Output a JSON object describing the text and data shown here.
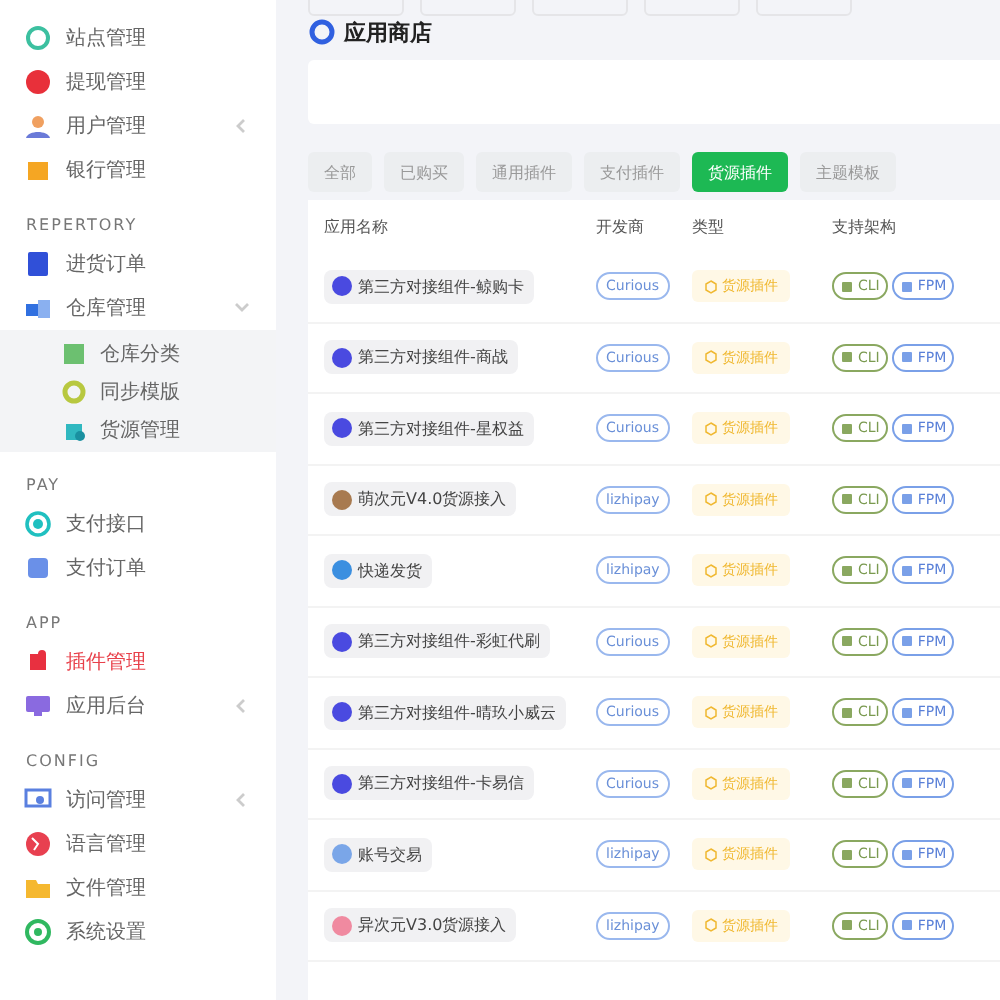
{
  "sidebar": {
    "sections": [
      {
        "items": [
          {
            "label": "站点管理",
            "kind": "link",
            "selected": false
          },
          {
            "label": "提现管理",
            "kind": "link",
            "selected": false
          },
          {
            "label": "用户管理",
            "kind": "menu",
            "expanded": false,
            "selected": false
          },
          {
            "label": "银行管理",
            "kind": "link",
            "selected": false
          }
        ]
      },
      {
        "title": "REPERTORY",
        "items": [
          {
            "label": "进货订单",
            "kind": "link",
            "selected": false
          },
          {
            "label": "仓库管理",
            "kind": "menu",
            "expanded": true,
            "selected": false,
            "children": [
              {
                "label": "仓库分类",
                "selected": false
              },
              {
                "label": "同步模版",
                "selected": false
              },
              {
                "label": "货源管理",
                "selected": false
              }
            ]
          }
        ]
      },
      {
        "title": "PAY",
        "items": [
          {
            "label": "支付接口",
            "kind": "link",
            "selected": false
          },
          {
            "label": "支付订单",
            "kind": "link",
            "selected": false
          }
        ]
      },
      {
        "title": "APP",
        "items": [
          {
            "label": "插件管理",
            "kind": "link",
            "selected": true
          },
          {
            "label": "应用后台",
            "kind": "menu",
            "expanded": false,
            "selected": false
          }
        ]
      },
      {
        "title": "CONFIG",
        "items": [
          {
            "label": "访问管理",
            "kind": "menu",
            "expanded": false,
            "selected": false
          },
          {
            "label": "语言管理",
            "kind": "link",
            "selected": false
          },
          {
            "label": "文件管理",
            "kind": "link",
            "selected": false
          },
          {
            "label": "系统设置",
            "kind": "link",
            "selected": false
          }
        ]
      }
    ]
  },
  "page_title": "应用商店",
  "tabs": [
    {
      "label": "全部",
      "selected": false
    },
    {
      "label": "已购买",
      "selected": false
    },
    {
      "label": "通用插件",
      "selected": false
    },
    {
      "label": "支付插件",
      "selected": false
    },
    {
      "label": "货源插件",
      "selected": true
    },
    {
      "label": "主题模板",
      "selected": false
    }
  ],
  "table": {
    "columns": [
      "应用名称",
      "开发商",
      "类型",
      "支持架构"
    ],
    "rows": [
      {
        "name": "第三方对接组件-鲸购卡",
        "color": "#4a4ae0",
        "developer": "Curious",
        "type": "货源插件",
        "archs": [
          "CLI",
          "FPM"
        ]
      },
      {
        "name": "第三方对接组件-商战",
        "color": "#4a4ae0",
        "developer": "Curious",
        "type": "货源插件",
        "archs": [
          "CLI",
          "FPM"
        ]
      },
      {
        "name": "第三方对接组件-星权益",
        "color": "#4a4ae0",
        "developer": "Curious",
        "type": "货源插件",
        "archs": [
          "CLI",
          "FPM"
        ]
      },
      {
        "name": "萌次元V4.0货源接入",
        "color": "#a87a50",
        "developer": "lizhipay",
        "type": "货源插件",
        "archs": [
          "CLI",
          "FPM"
        ]
      },
      {
        "name": "快递发货",
        "color": "#3b8fe0",
        "developer": "lizhipay",
        "type": "货源插件",
        "archs": [
          "CLI",
          "FPM"
        ]
      },
      {
        "name": "第三方对接组件-彩虹代刷",
        "color": "#4a4ae0",
        "developer": "Curious",
        "type": "货源插件",
        "archs": [
          "CLI",
          "FPM"
        ]
      },
      {
        "name": "第三方对接组件-晴玖小威云",
        "color": "#4a4ae0",
        "developer": "Curious",
        "type": "货源插件",
        "archs": [
          "CLI",
          "FPM"
        ]
      },
      {
        "name": "第三方对接组件-卡易信",
        "color": "#4a4ae0",
        "developer": "Curious",
        "type": "货源插件",
        "archs": [
          "CLI",
          "FPM"
        ]
      },
      {
        "name": "账号交易",
        "color": "#7aa6e8",
        "developer": "lizhipay",
        "type": "货源插件",
        "archs": [
          "CLI",
          "FPM"
        ]
      },
      {
        "name": "异次元V3.0货源接入",
        "color": "#f08aa0",
        "developer": "lizhipay",
        "type": "货源插件",
        "archs": [
          "CLI",
          "FPM"
        ]
      }
    ]
  }
}
